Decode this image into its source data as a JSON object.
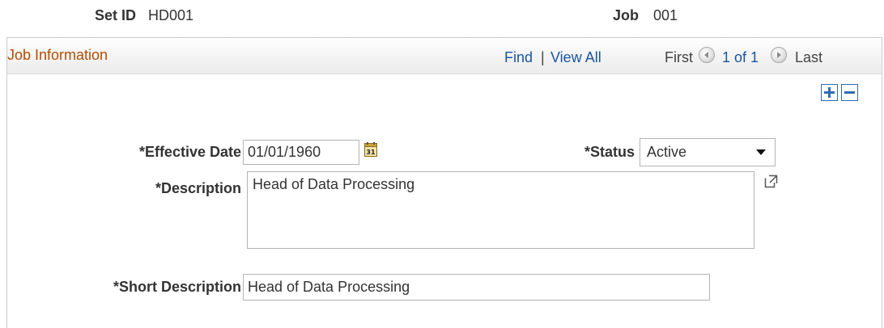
{
  "header": {
    "set_id_label": "Set ID",
    "set_id_value": "HD001",
    "job_label": "Job",
    "job_value": "001"
  },
  "group": {
    "title": "Job Information",
    "find_link": "Find",
    "separator": "|",
    "view_all_link": "View All",
    "first_label": "First",
    "page_status": "1 of 1",
    "last_label": "Last"
  },
  "form": {
    "effective_date_label": "*Effective Date",
    "effective_date_value": "01/01/1960",
    "calendar_icon_text": "31",
    "status_label": "*Status",
    "status_value": "Active",
    "description_label": "*Description",
    "description_value": "Head of Data Processing",
    "short_description_label": "*Short Description",
    "short_description_value": "Head of Data Processing"
  },
  "icons": {
    "prev": "prev-arrow-icon",
    "next": "next-arrow-icon",
    "add_row": "plus-icon",
    "delete_row": "minus-icon",
    "calendar": "calendar-icon",
    "dropdown": "dropdown-arrow-icon",
    "expand": "expand-popup-icon"
  },
  "colors": {
    "group_title": "#b34d00",
    "link": "#1a56a0",
    "row_button": "#2d6bb3"
  }
}
